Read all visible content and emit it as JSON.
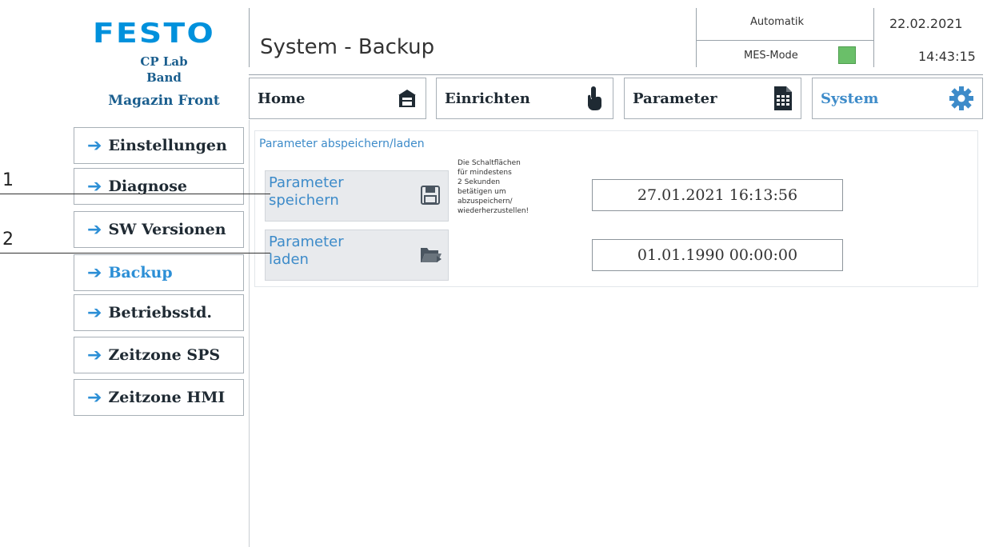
{
  "logo": {
    "brand": "FESTO",
    "line1": "CP Lab",
    "line2": "Band",
    "line3": "Magazin Front"
  },
  "header": {
    "title": "System - Backup",
    "mode": "Automatik",
    "mes_mode": "MES-Mode",
    "date": "22.02.2021",
    "time": "14:43:15"
  },
  "nav": {
    "tabs": [
      {
        "label": "Home",
        "icon": "cabinet-icon"
      },
      {
        "label": "Einrichten",
        "icon": "hand-pointer-icon"
      },
      {
        "label": "Parameter",
        "icon": "document-table-icon"
      },
      {
        "label": "System",
        "icon": "gear-icon",
        "active": true
      }
    ]
  },
  "sidebar": {
    "items": [
      {
        "label": "Einstellungen"
      },
      {
        "label": "Diagnose"
      },
      {
        "label": "SW Versionen"
      },
      {
        "label": "Backup",
        "active": true
      },
      {
        "label": "Betriebsstd."
      },
      {
        "label": "Zeitzone SPS"
      },
      {
        "label": "Zeitzone HMI"
      }
    ]
  },
  "main": {
    "section_title": "Parameter abspeichern/laden",
    "save_button": {
      "line1": "Parameter",
      "line2": "speichern",
      "icon": "floppy-disk-icon"
    },
    "load_button": {
      "line1": "Parameter",
      "line2": "laden",
      "icon": "folder-open-icon"
    },
    "hint": [
      "Die Schaltflächen",
      "für mindestens",
      "2 Sekunden",
      "betätigen um",
      "abzuspeichern/",
      "wiederherzustellen!"
    ],
    "save_timestamp": "27.01.2021 16:13:56",
    "load_timestamp": "01.01.1990 00:00:00"
  },
  "annotations": {
    "one": "1",
    "two": "2"
  },
  "colors": {
    "accent": "#3d8bc9",
    "brand": "#0091dc",
    "mes_ok": "#6abf69"
  }
}
